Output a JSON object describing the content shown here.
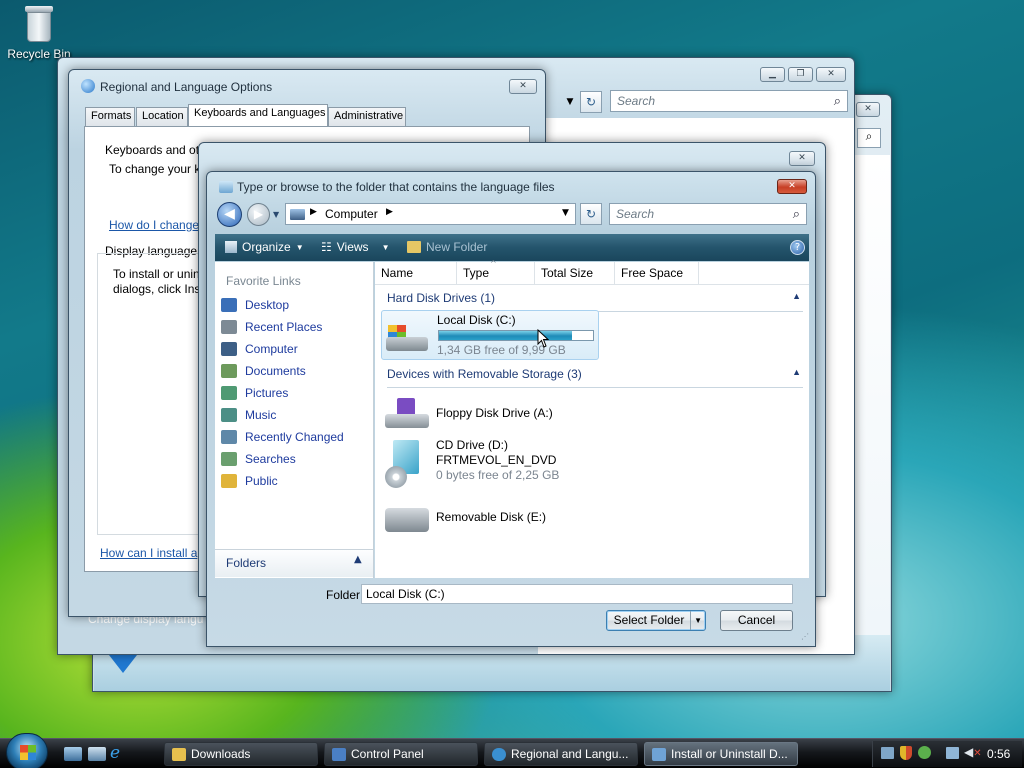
{
  "desktop": {
    "recycle_bin_label": "Recycle Bin"
  },
  "control_panel_window": {
    "search_placeholder": "Search",
    "icons": [
      "minimize-icon",
      "maximize-icon",
      "close-icon",
      "refresh-icon",
      "search-icon"
    ]
  },
  "back_window": {
    "status_text": "Change display langu"
  },
  "regional_window": {
    "title": "Regional and Language Options",
    "tabs": [
      "Formats",
      "Location",
      "Keyboards and Languages",
      "Administrative"
    ],
    "active_tab": "Keyboards and Languages",
    "keyboards_heading": "Keyboards and ot",
    "keyboards_text": "To change your k",
    "keyboards_link": "How do I change",
    "display_heading": "Display language",
    "display_text_1": "To install or unin",
    "display_text_2": "dialogs, click Ins",
    "install_link": "How can I install a"
  },
  "browse_dialog": {
    "title": "Type or browse to the folder that contains the language files",
    "address": {
      "crumb": "Computer"
    },
    "search_placeholder": "Search",
    "toolbar": {
      "organize": "Organize",
      "views": "Views",
      "new_folder": "New Folder"
    },
    "nav": {
      "favorite_links_label": "Favorite Links",
      "items": [
        {
          "label": "Desktop",
          "icon": "desktop-icon",
          "color": "#3a6fb8"
        },
        {
          "label": "Recent Places",
          "icon": "recent-places-icon",
          "color": "#7d8a95"
        },
        {
          "label": "Computer",
          "icon": "computer-icon",
          "color": "#3d5f86"
        },
        {
          "label": "Documents",
          "icon": "documents-icon",
          "color": "#6d9a5c"
        },
        {
          "label": "Pictures",
          "icon": "pictures-icon",
          "color": "#4f9a73"
        },
        {
          "label": "Music",
          "icon": "music-icon",
          "color": "#4c8f86"
        },
        {
          "label": "Recently Changed",
          "icon": "recently-changed-icon",
          "color": "#5f88a8"
        },
        {
          "label": "Searches",
          "icon": "searches-icon",
          "color": "#6a9f6e"
        },
        {
          "label": "Public",
          "icon": "public-icon",
          "color": "#e0b43a"
        }
      ],
      "folders_label": "Folders"
    },
    "columns": [
      "Name",
      "Type",
      "Total Size",
      "Free Space"
    ],
    "groups": {
      "hard_disk": {
        "label": "Hard Disk Drives (1)",
        "drives": [
          {
            "name": "Local Disk (C:)",
            "detail": "1,34 GB free of 9,99 GB",
            "used_fraction": 0.866
          }
        ]
      },
      "removable": {
        "label": "Devices with Removable Storage (3)",
        "drives": [
          {
            "name": "Floppy Disk Drive (A:)"
          },
          {
            "name": "CD Drive (D:)",
            "label2": "FRTMEVOL_EN_DVD",
            "detail": "0 bytes free of 2,25 GB"
          },
          {
            "name": "Removable Disk (E:)"
          }
        ]
      }
    },
    "folder_label": "Folder:",
    "folder_value": "Local Disk (C:)",
    "select_button": "Select Folder",
    "cancel_button": "Cancel"
  },
  "taskbar": {
    "buttons": [
      {
        "label": "Downloads",
        "icon": "folder-icon",
        "color": "#e7c04e"
      },
      {
        "label": "Control Panel",
        "icon": "control-panel-icon",
        "color": "#4a7fc4"
      },
      {
        "label": "Regional and Langu...",
        "icon": "globe-icon",
        "color": "#3a8fd0"
      },
      {
        "label": "Install or Uninstall D...",
        "icon": "install-icon",
        "color": "#6fa3d6"
      }
    ],
    "clock": "0:56"
  }
}
